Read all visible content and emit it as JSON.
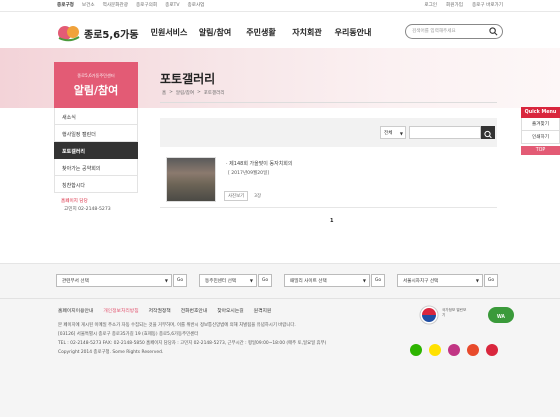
{
  "topbar": {
    "left": [
      "종로구청",
      "보건소",
      "역사문화관광",
      "종로구의회",
      "종로TV",
      "종로사업"
    ],
    "right": [
      "로그인",
      "회원가입",
      "종로구 바로가기"
    ]
  },
  "header": {
    "brand": "종로5,6가동",
    "gnb": [
      "민원서비스",
      "알림/참여",
      "주민생활",
      "자치회관",
      "우리동안내"
    ],
    "search_placeholder": "검색어를 입력해주세요"
  },
  "lnb": {
    "sub": "종로5,6가동주민센터",
    "title": "알림/참여",
    "items": [
      "새소식",
      "행사일정 캘린더",
      "포토갤러리",
      "찾아가는 공약회의",
      "칭찬합시다"
    ],
    "active_index": 2,
    "contact_title": "홈페이지 담당",
    "contact_phone": "고민지 02-2148-5273"
  },
  "content": {
    "title": "포토갤러리",
    "breadcrumb": [
      "홈",
      ">",
      "알림/참여",
      ">",
      "포토갤러리"
    ],
    "filter_select": "전체",
    "post": {
      "title": "· 제148회 가을맞이 동자치회의",
      "date": "[ 2017년09월20일]",
      "hit_label": "사진보기",
      "hit_count": "3장"
    },
    "page": "1"
  },
  "quick": {
    "title": "Quick Menu",
    "items": [
      "즐겨찾기",
      "인쇄하기"
    ],
    "top": "TOP"
  },
  "footer": {
    "selects": [
      "관련부서 선택",
      "동주민센터 선택",
      "패밀리 사이트 선택",
      "서울시자치구 선택"
    ],
    "go": "Go",
    "links": [
      "홈페이지이용안내",
      "개인정보처리방침",
      "저작권정책",
      "전화번호안내",
      "찾아오시는길",
      "원격지원"
    ],
    "highlight_link_index": 1,
    "info": [
      "본 페이지에 게시된 이메일 주소가 자동 수집되는 것을 거부하며, 이를 위반시 정보통신망법에 의해 처벌됨을 유념하시기 바랍니다.",
      "[03126] 서울특별시 종로구 종로35가길 19 (효제동) 종로5,6가동주민센터",
      "TEL : 02-2148-5273 FAX: 02-2148-5850 홈페이지 담당자 : 고민지 02-2148-5273, 근무시간 : 평일09:00~18:00 (매주 토,일요일 휴무)",
      "Copyright 2014 종로구청. Some Rights Reserved."
    ],
    "badge_text": "국가정보 열린보기"
  },
  "colors": {
    "accent": "#e35b75",
    "quick_header": "#d9263d",
    "active_menu": "#333333"
  }
}
